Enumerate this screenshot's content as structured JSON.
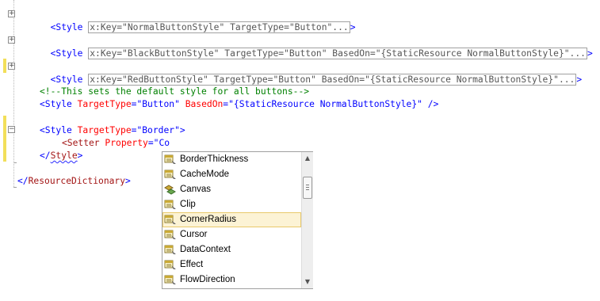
{
  "editor": {
    "line1": {
      "tag": "<Style",
      "collapsed": "x:Key=\"NormalButtonStyle\" TargetType=\"Button\"...",
      "close": ">"
    },
    "line2": {
      "tag": "<Style",
      "collapsed": "x:Key=\"BlackButtonStyle\" TargetType=\"Button\" BasedOn=\"{StaticResource NormalButtonStyle}\"...",
      "close": ">"
    },
    "line3": {
      "tag": "<Style",
      "collapsed": "x:Key=\"RedButtonStyle\" TargetType=\"Button\" BasedOn=\"{StaticResource NormalButtonStyle}\"...",
      "close": ">"
    },
    "comment": "<!--This sets the default style for all buttons-->",
    "default_style": {
      "open": "<Style",
      "attr1": "TargetType",
      "eq1": "=\"",
      "val1": "Button",
      "q1": "\"",
      "attr2": "BasedOn",
      "eq2": "=\"",
      "val2": "{StaticResource NormalButtonStyle}",
      "q2": "\"",
      "close": " />"
    },
    "border_style": {
      "open": "<Style",
      "attr": "TargetType",
      "eq": "=\"",
      "val": "Border",
      "q": "\"",
      "close": ">"
    },
    "setter": {
      "open": "<Setter",
      "attr": "Property",
      "eq": "=\"",
      "val": "Co"
    },
    "style_close": {
      "lt": "</",
      "name": "Style",
      "gt": ">"
    },
    "dict_close": {
      "lt": "</",
      "name": "ResourceDictionary",
      "gt": ">"
    },
    "fold_expand_glyph": "+",
    "fold_collapse_glyph": "−"
  },
  "intellisense": {
    "items": [
      {
        "label": "BorderThickness",
        "icon": "property-icon"
      },
      {
        "label": "CacheMode",
        "icon": "property-icon"
      },
      {
        "label": "Canvas",
        "icon": "attached-property-icon"
      },
      {
        "label": "Clip",
        "icon": "property-icon"
      },
      {
        "label": "CornerRadius",
        "icon": "property-icon",
        "selected": true
      },
      {
        "label": "Cursor",
        "icon": "property-icon"
      },
      {
        "label": "DataContext",
        "icon": "property-icon"
      },
      {
        "label": "Effect",
        "icon": "property-icon"
      },
      {
        "label": "FlowDirection",
        "icon": "property-icon"
      }
    ],
    "scroll_up_glyph": "▲",
    "scroll_down_glyph": "▼"
  }
}
